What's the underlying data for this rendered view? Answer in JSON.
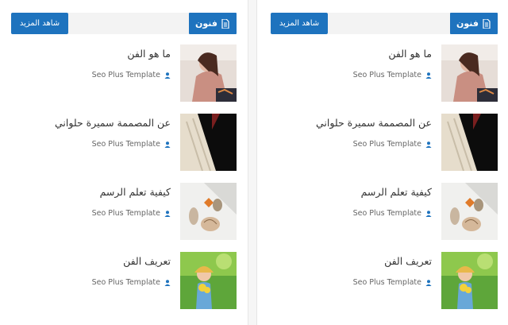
{
  "widget": {
    "category_label": "فنون",
    "see_more_label": "شاهد المزيد",
    "posts": [
      {
        "title": "ما هو الفن",
        "author": "Seo Plus Template"
      },
      {
        "title": "عن المصممة سميرة حلواني",
        "author": "Seo Plus Template"
      },
      {
        "title": "كيفية تعلم الرسم",
        "author": "Seo Plus Template"
      },
      {
        "title": "تعريف الفن",
        "author": "Seo Plus Template"
      }
    ]
  },
  "icons": {
    "category": "document-icon",
    "author": "user-icon"
  },
  "colors": {
    "accent": "#1e73be",
    "header_bar": "#f3f3f3",
    "text": "#333333",
    "meta": "#666666"
  }
}
